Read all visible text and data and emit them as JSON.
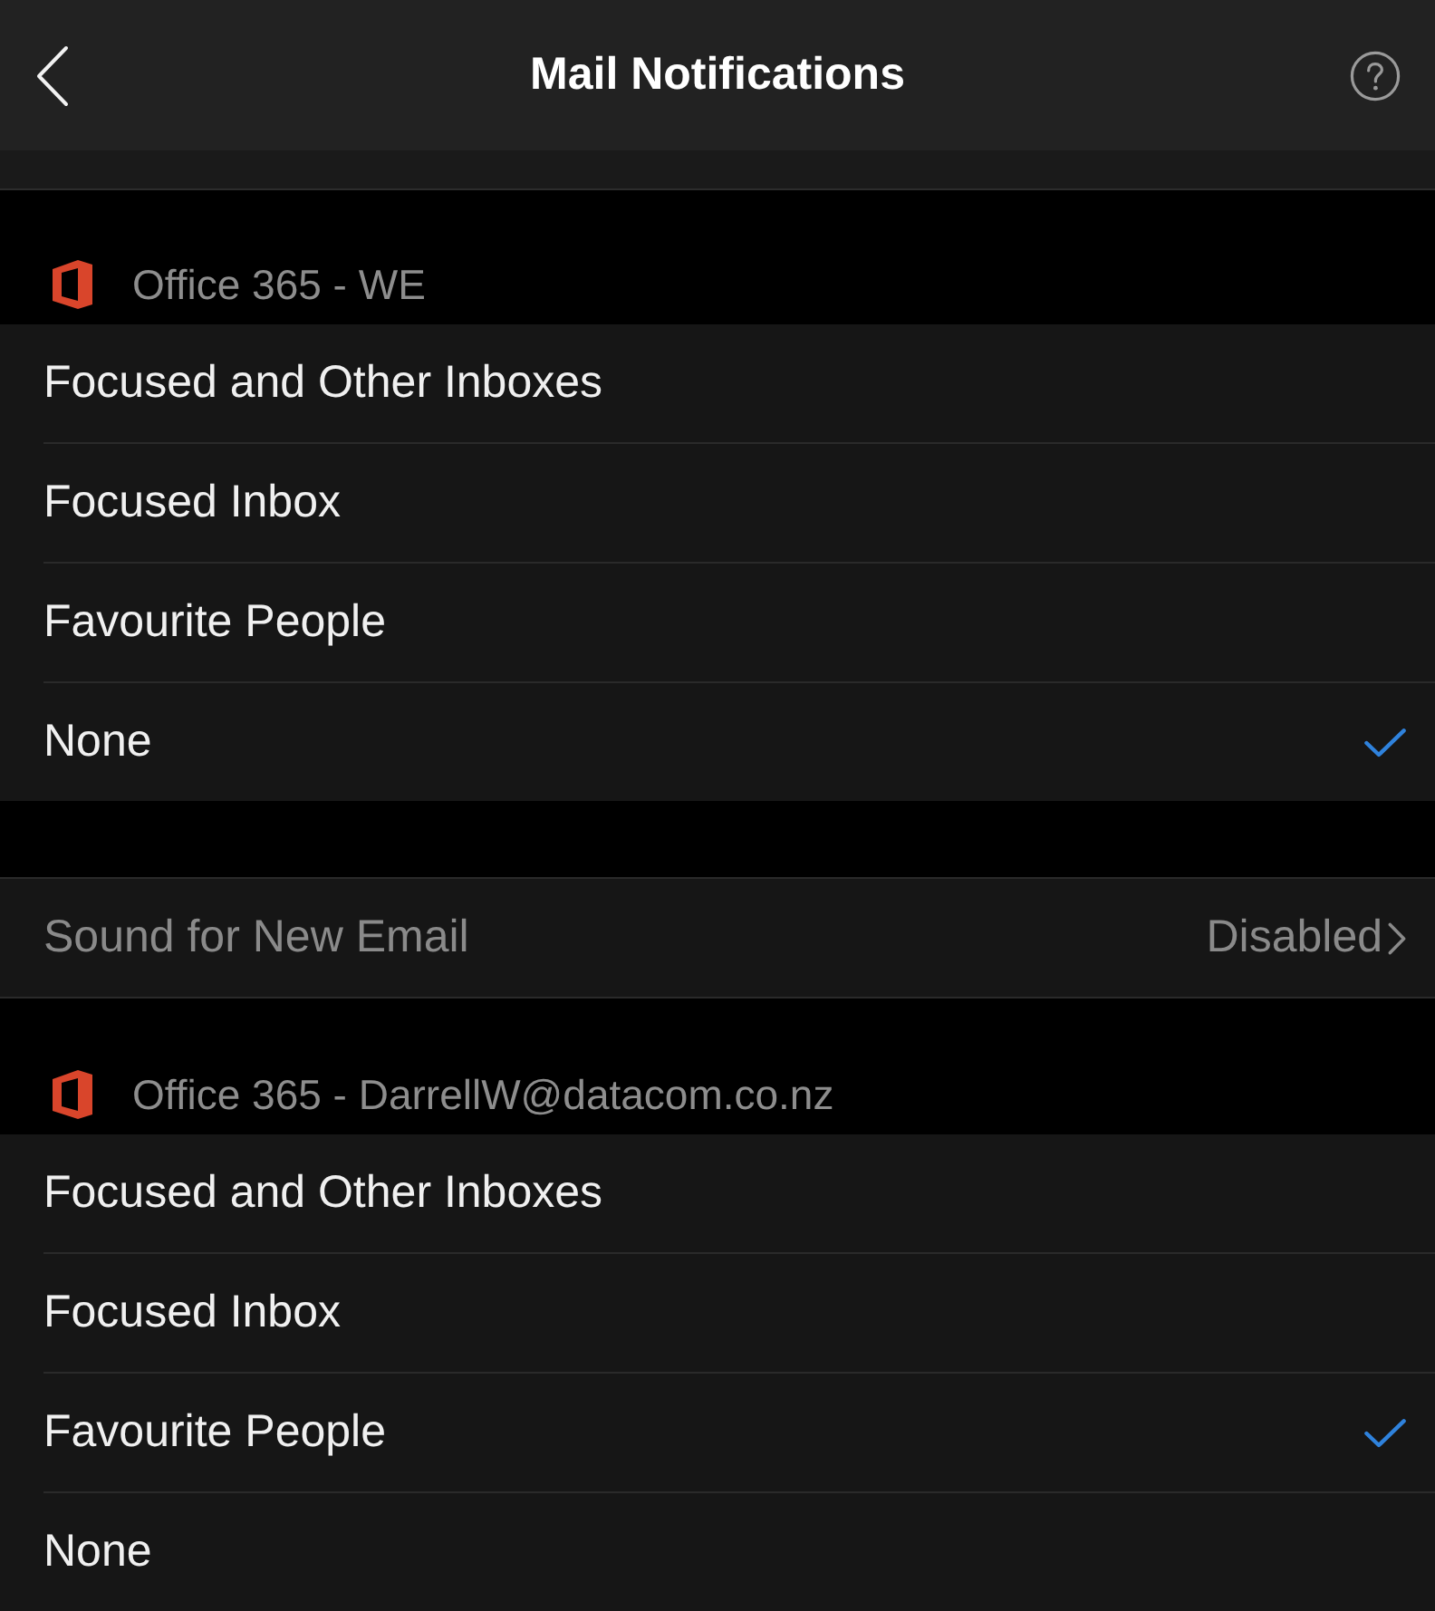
{
  "header": {
    "title": "Mail Notifications"
  },
  "sections": [
    {
      "kind": "account",
      "title": "Office 365 - WE",
      "options": [
        {
          "label": "Focused and Other Inboxes",
          "selected": false
        },
        {
          "label": "Focused Inbox",
          "selected": false
        },
        {
          "label": "Favourite People",
          "selected": false
        },
        {
          "label": "None",
          "selected": true
        }
      ]
    },
    {
      "kind": "setting",
      "label": "Sound for New Email",
      "value": "Disabled",
      "disabled": true
    },
    {
      "kind": "account",
      "title": "Office 365 - DarrellW@datacom.co.nz",
      "options": [
        {
          "label": "Focused and Other Inboxes",
          "selected": false
        },
        {
          "label": "Focused Inbox",
          "selected": false
        },
        {
          "label": "Favourite People",
          "selected": true
        },
        {
          "label": "None",
          "selected": false
        }
      ]
    }
  ]
}
